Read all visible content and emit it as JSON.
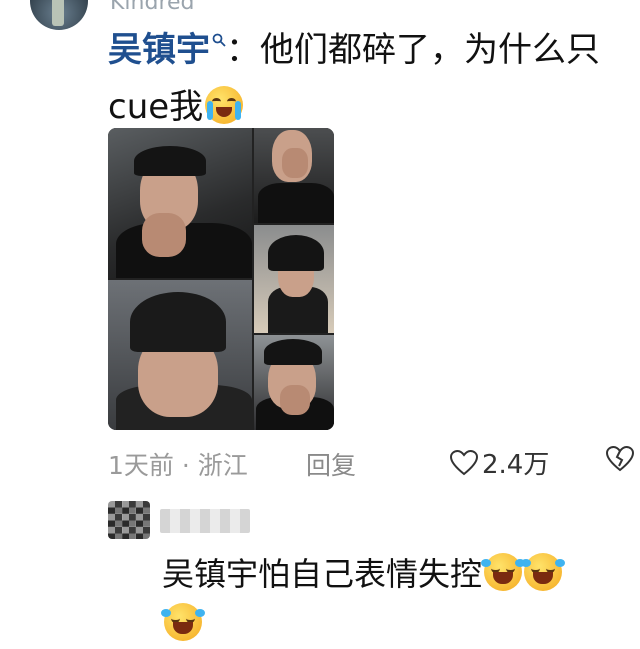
{
  "top_comment": {
    "author_partial": "Kindred",
    "mention": "吴镇宇",
    "text": "：他们都碎了，为什么只cue我",
    "emoji": "loudly-crying-face-icon"
  },
  "meta": {
    "time_location": "1天前 · 浙江",
    "reply_label": "回复",
    "like_count": "2.4万"
  },
  "reply": {
    "text": "吴镇宇怕自己表情失控",
    "emojis": [
      "rolling-on-floor-laughing-icon",
      "rolling-on-floor-laughing-icon",
      "rolling-on-floor-laughing-icon"
    ]
  },
  "colors": {
    "mention": "#1f4f8f",
    "meta": "#9a9a9a"
  }
}
